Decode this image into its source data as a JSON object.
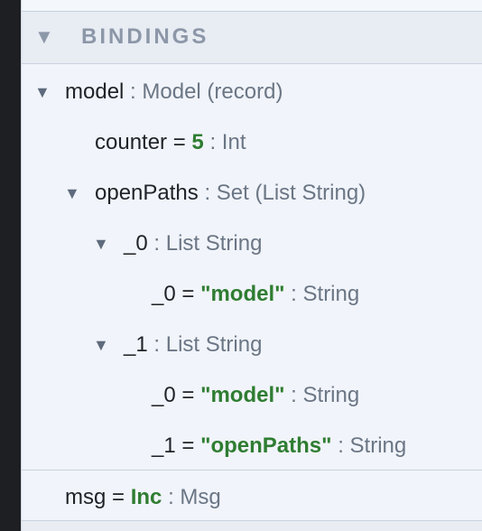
{
  "section": {
    "title": "BINDINGS",
    "caret": "▼"
  },
  "bindings": [
    {
      "caret": "▼",
      "name": "model",
      "separator": ":",
      "type": "Model (record)"
    },
    {
      "name": "counter",
      "operator": "=",
      "value": "5",
      "separator": ":",
      "type": "Int"
    },
    {
      "caret": "▼",
      "name": "openPaths",
      "separator": ":",
      "type": "Set (List String)"
    },
    {
      "caret": "▼",
      "name": "_0",
      "separator": ":",
      "type": "List String"
    },
    {
      "name": "_0",
      "operator": "=",
      "value": "\"model\"",
      "separator": ":",
      "type": "String"
    },
    {
      "caret": "▼",
      "name": "_1",
      "separator": ":",
      "type": "List String"
    },
    {
      "name": "_0",
      "operator": "=",
      "value": "\"model\"",
      "separator": ":",
      "type": "String"
    },
    {
      "name": "_1",
      "operator": "=",
      "value": "\"openPaths\"",
      "separator": ":",
      "type": "String"
    },
    {
      "name": "msg",
      "operator": "=",
      "value": "Inc",
      "separator": ":",
      "type": "Msg"
    }
  ]
}
